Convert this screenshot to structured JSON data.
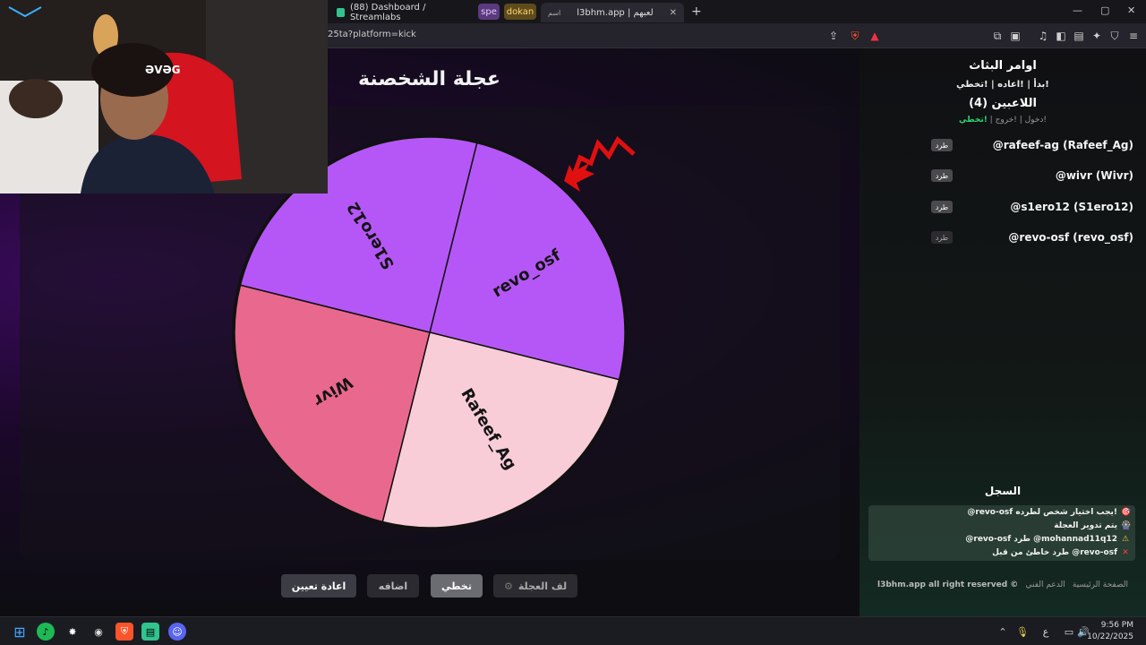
{
  "browser": {
    "tabs": [
      {
        "label": "(88) Dashboard / Streamlabs"
      },
      {
        "label": "spe"
      },
      {
        "label": "dokan"
      },
      {
        "label": "l3bhm.app | لعبهم",
        "prefix": "اسم"
      }
    ],
    "new_tab": "+",
    "url": "25ta?platform=kick",
    "window_controls": {
      "minimize": "—",
      "maximize": "▢",
      "close": "✕"
    }
  },
  "wheel": {
    "title": "عجلة الشخصنة",
    "segments": [
      {
        "label": "revo_osf",
        "color": "#b557f6"
      },
      {
        "label": "Rafeef_Ag",
        "color": "#f8cdd8"
      },
      {
        "label": "Wivr",
        "color": "#e9688e"
      },
      {
        "label": "S1ero12",
        "color": "#b557f6"
      }
    ],
    "pointer_color": "#e11010"
  },
  "buttons": {
    "reset": "اعادة تعيين",
    "add": "اضافه",
    "skip": "تخطي",
    "spin": "لف العجلة",
    "spin_icon": "⚙"
  },
  "right_panel": {
    "commands_title": "اوامر البثاث",
    "commands_list": "!بدأ | !اعاده | !تخطي",
    "players_title": "اللاعبين (4)",
    "players_cmds": {
      "join": "!دخول",
      "leave": "!خروج",
      "skip": "!تخطي"
    },
    "players": [
      {
        "name": "@rafeef-ag (Rafeef_Ag)",
        "kick": "طرد"
      },
      {
        "name": "@wivr (Wivr)",
        "kick": "طرد"
      },
      {
        "name": "@s1ero12 (S1ero12)",
        "kick": "طرد"
      },
      {
        "name": "@revo-osf (revo_osf)",
        "kick": "طرد"
      }
    ],
    "log_title": "السجل",
    "log": [
      {
        "icon": "🎯",
        "text": "@revo-osf يجب اختيار شخص لطرده!"
      },
      {
        "icon": "🎡",
        "text": "يتم تدوير العجلة"
      },
      {
        "icon": "⚠",
        "text": "@revo-osf طرد @mohannad11q12"
      },
      {
        "icon": "✕",
        "text": "طرد خاطئ من قبل @revo-osf"
      }
    ],
    "footer": {
      "home": "الصفحة الرئيسية",
      "support": "الدعم الفني",
      "copyright": "l3bhm.app all right reserved ©"
    }
  },
  "taskbar": {
    "time": "9:56 PM",
    "date": "10/22/2025",
    "lang": "ع"
  }
}
